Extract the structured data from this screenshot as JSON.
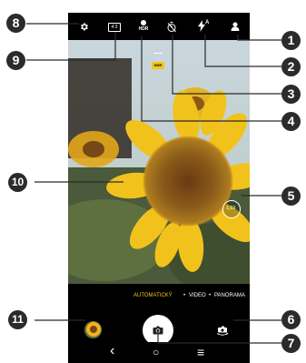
{
  "topbar": {
    "icons": [
      "gear-icon",
      "aspect-ratio-icon",
      "hdr-icon",
      "timer-off-icon",
      "flash-auto-icon",
      "beauty-icon"
    ],
    "aspect_ratio_label": "4:3",
    "hdr_label": "HDR",
    "flash_auto_label": "A"
  },
  "viewfinder": {
    "hdr_badge": "HDR",
    "zoom_label": "1,0X"
  },
  "modes": {
    "items": [
      "AUTOMATICKÝ",
      "VIDEO",
      "PANORAMA"
    ],
    "separator": "•",
    "active": "AUTOMATICKÝ",
    "active_color": "#f5c518"
  },
  "controls": {
    "gallery_thumbnail": "thumbnail-image",
    "shutter_icon": "camera-icon",
    "switch_icon": "camera-switch-icon"
  },
  "navbar": {
    "back_glyph": "‹",
    "home_glyph": "○",
    "recents_glyph": "≡"
  },
  "callouts": [
    "1",
    "2",
    "3",
    "4",
    "5",
    "6",
    "7",
    "8",
    "9",
    "10",
    "11"
  ]
}
